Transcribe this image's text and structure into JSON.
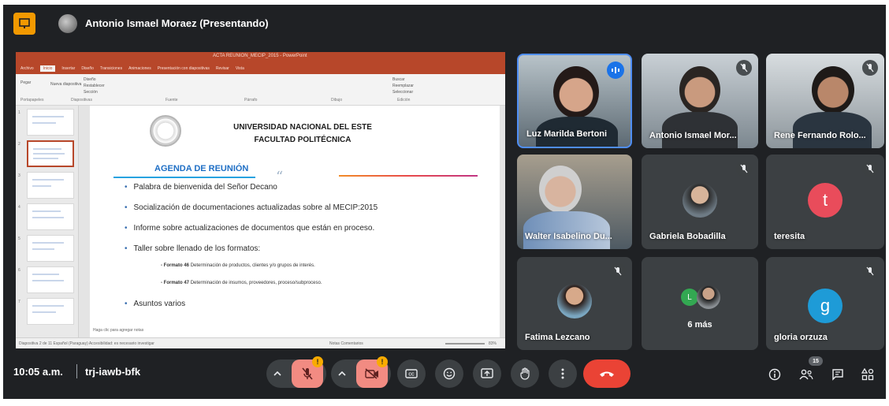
{
  "presenter": {
    "badge_icon": "present-screen-icon",
    "title": "Antonio Ismael Moraez (Presentando)"
  },
  "presentation": {
    "app_title": "ACTA REUNION_MECIP_2015 - PowerPoint",
    "tabs": [
      "Archivo",
      "Inicio",
      "Insertar",
      "Diseño",
      "Transiciones",
      "Animaciones",
      "Presentación con diapositivas",
      "Revisar",
      "Vista"
    ],
    "ribbon_groups": [
      "Portapapeles",
      "Diapositivas",
      "Fuente",
      "Párrafo",
      "Dibujo",
      "Edición"
    ],
    "ribbon_buttons": [
      "Pegar",
      "Nueva diapositiva",
      "Diseño",
      "Restablecer",
      "Sección",
      "Buscar",
      "Reemplazar",
      "Seleccionar"
    ],
    "slide": {
      "university": "UNIVERSIDAD NACIONAL DEL ESTE",
      "faculty": "FACULTAD POLITÉCNICA",
      "agenda_title": "AGENDA DE REUNIÓN",
      "quote_mark": "“",
      "bullets": [
        "Palabra de bienvenida del Señor Decano",
        "Socialización de documentaciones actualizadas sobre al MECIP:2015",
        "Informe sobre actualizaciones de documentos que están en proceso.",
        "Taller sobre llenado de los formatos:"
      ],
      "sub_items": [
        {
          "label": "- Formato 46",
          "text": "Determinación de productos, clientes y/o grupos de interés."
        },
        {
          "label": "- Formato 47",
          "text": "Determinación de insumos, proveedores, proceso/subproceso."
        }
      ],
      "last_bullet": "Asuntos varios",
      "notes_hint": "Haga clic para agregar notas"
    },
    "status": {
      "left": "Diapositiva 2 de 11    Español (Paraguay)    Accesibilidad: es necesario investigar",
      "right": "Notas    Comentarios",
      "zoom": "83%"
    }
  },
  "participants": [
    {
      "name": "Luz Marilda Bertoni",
      "state": "speaking"
    },
    {
      "name": "Antonio Ismael Mor...",
      "state": "presenting"
    },
    {
      "name": "Rene Fernando Rolo...",
      "state": "presenting"
    },
    {
      "name": "Walter Isabelino Du...",
      "state": "video"
    },
    {
      "name": "Gabriela Bobadilla",
      "state": "muted"
    },
    {
      "name": "teresita",
      "state": "muted",
      "letter": "t",
      "color": "#e94c5b"
    },
    {
      "name": "Fatima Lezcano",
      "state": "muted"
    },
    {
      "more_label": "6 más",
      "letter": "L",
      "color": "#33a852"
    },
    {
      "name": "gloria orzuza",
      "state": "muted",
      "letter": "g",
      "color": "#1e9bd7"
    }
  ],
  "controls": {
    "time": "10:05 a.m.",
    "meeting_code": "trj-iawb-bfk",
    "mic_icon": "mic-off-icon",
    "camera_icon": "camera-off-icon",
    "captions_icon": "captions-icon",
    "emoji_icon": "emoji-icon",
    "present_icon": "present-icon",
    "hand_icon": "raise-hand-icon",
    "more_icon": "more-options-icon",
    "end_call_icon": "end-call-icon",
    "warning": "!",
    "people_count": "15",
    "info_icon": "info-icon",
    "people_icon": "people-icon",
    "chat_icon": "chat-icon",
    "activities_icon": "activities-icon"
  },
  "colors": {
    "background": "#1f2124",
    "tile": "#3c4043",
    "active_speaker": "#4f8ef5",
    "end_call": "#ea4335",
    "alert_button": "#f28b82",
    "warning": "#f9ab00",
    "ppt_accent": "#b7472a",
    "agenda_title": "#1f6fc5"
  }
}
